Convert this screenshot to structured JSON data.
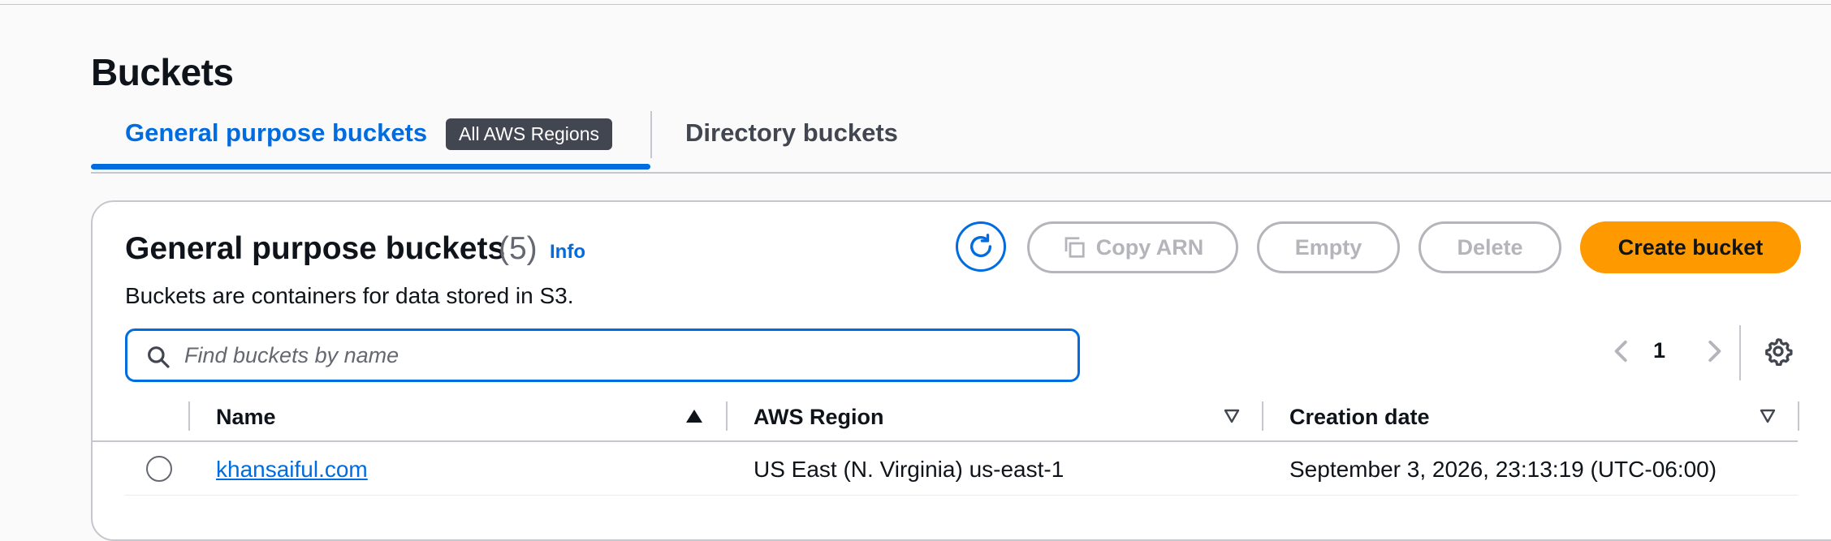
{
  "page": {
    "title": "Buckets"
  },
  "tabs": {
    "general": {
      "label": "General purpose buckets",
      "badge": "All AWS Regions"
    },
    "directory": {
      "label": "Directory buckets"
    }
  },
  "panel": {
    "title": "General purpose buckets",
    "count": "(5)",
    "info": "Info",
    "description": "Buckets are containers for data stored in S3.",
    "actions": {
      "refresh_icon": "refresh-icon",
      "copy_arn": "Copy ARN",
      "copy_icon": "copy-icon",
      "empty": "Empty",
      "delete": "Delete",
      "create": "Create bucket"
    },
    "search": {
      "placeholder": "Find buckets by name",
      "value": ""
    },
    "pagination": {
      "current_page": "1"
    },
    "columns": [
      {
        "label": "Name",
        "sort": "ascending"
      },
      {
        "label": "AWS Region",
        "sort": "none"
      },
      {
        "label": "Creation date",
        "sort": "none"
      }
    ],
    "rows": [
      {
        "name": "khansaiful.com",
        "region": "US East (N. Virginia) us-east-1",
        "created": "September 3, 2026, 23:13:19 (UTC-06:00)"
      }
    ]
  },
  "colors": {
    "link_blue": "#006ce0",
    "primary_orange": "#ff9900",
    "badge_bg": "#424650",
    "disabled_border": "#b4b4bb"
  }
}
